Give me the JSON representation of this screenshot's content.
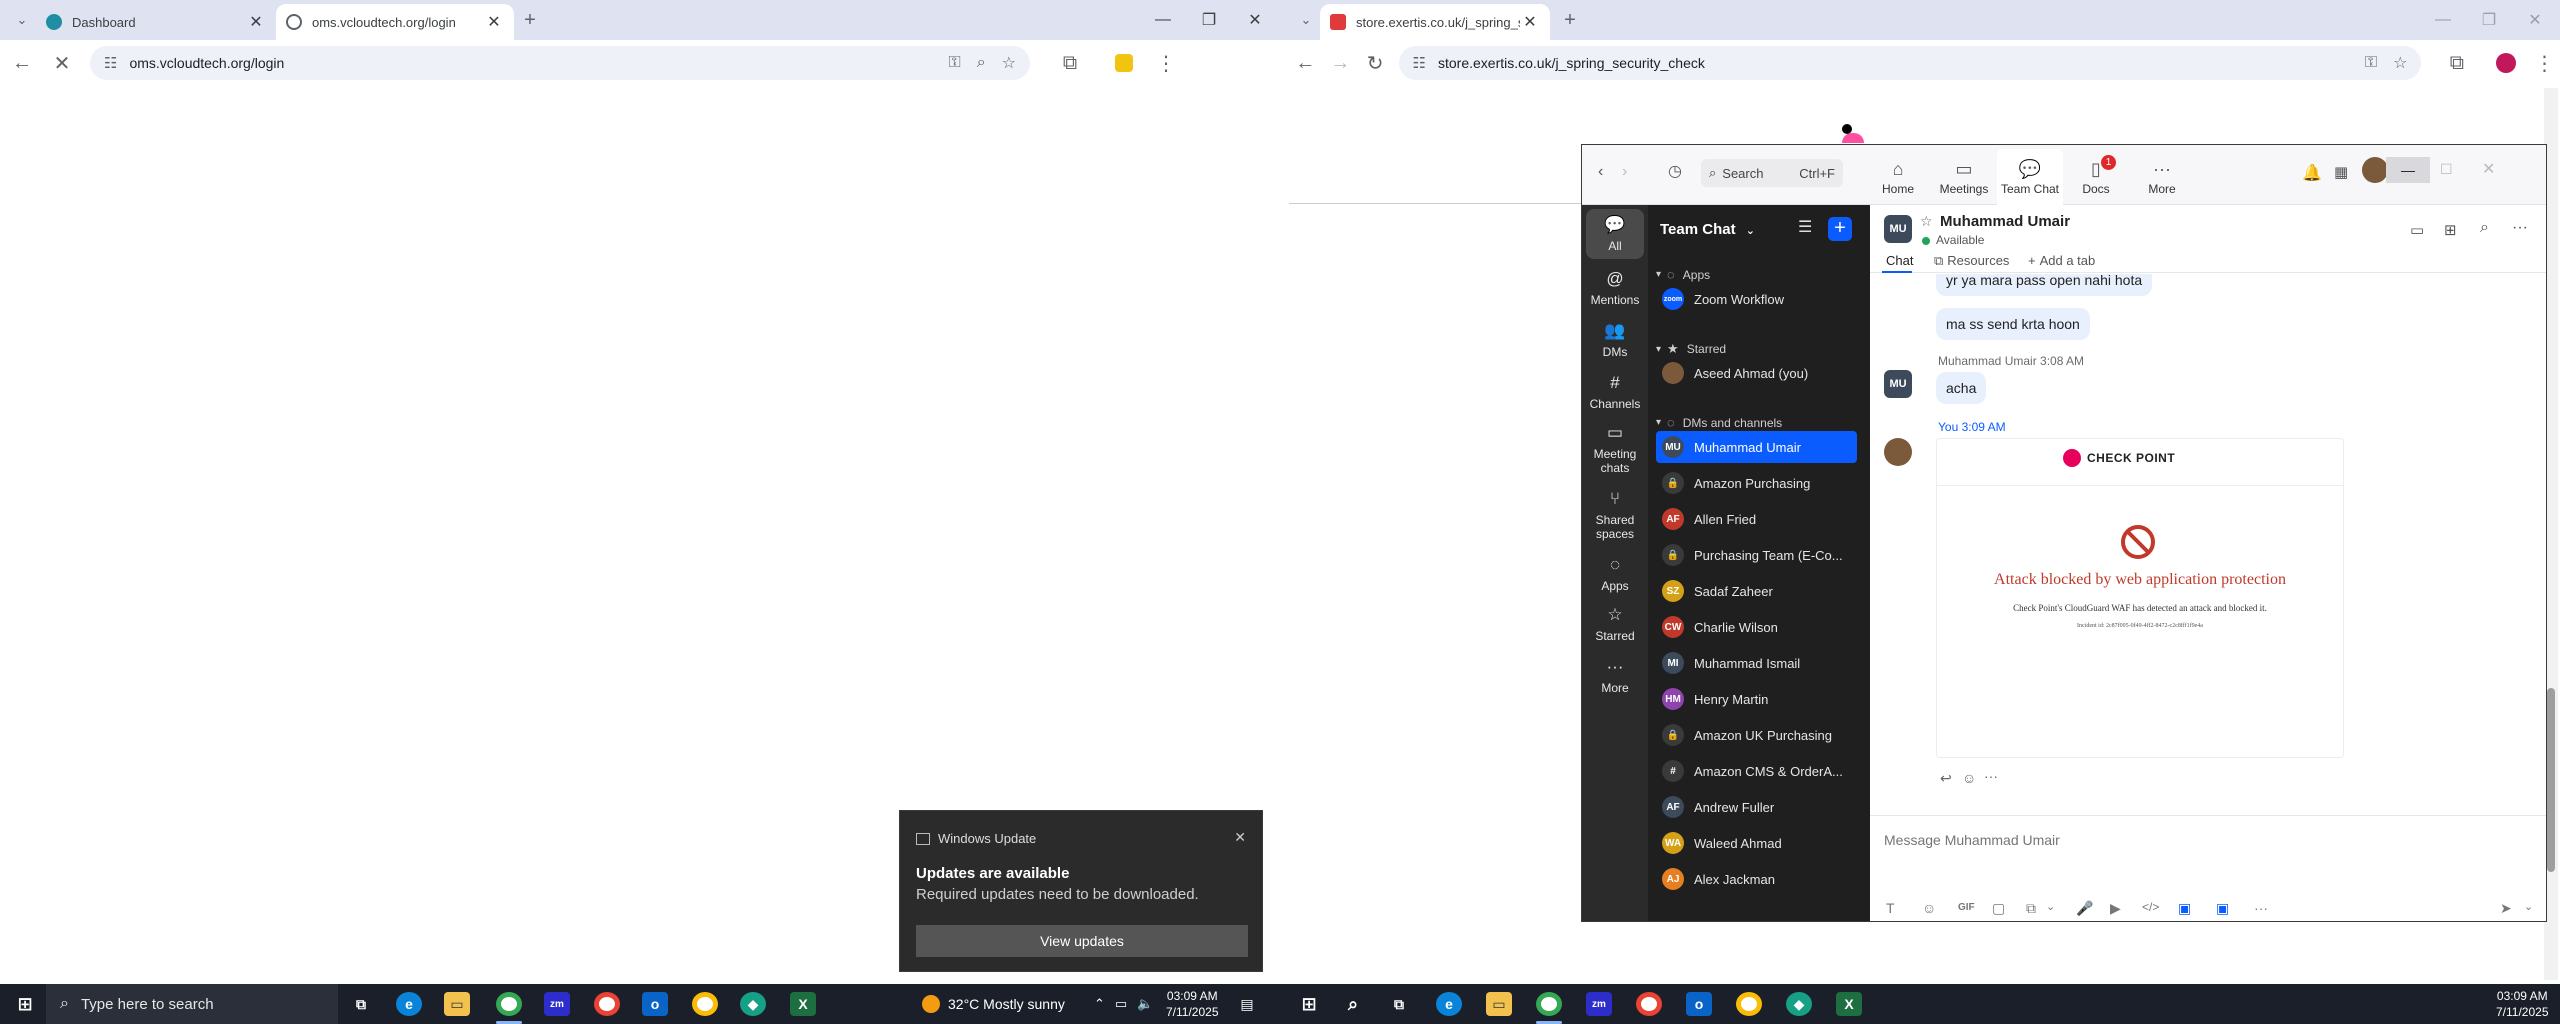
{
  "left_browser": {
    "tabs": [
      {
        "title": "Dashboard",
        "close": "✕"
      },
      {
        "title": "oms.vcloudtech.org/login",
        "close": "✕"
      }
    ],
    "new_tab": "+",
    "url": "oms.vcloudtech.org/login",
    "controls": {
      "minimize": "—",
      "restore": "❐",
      "close": "✕"
    }
  },
  "right_browser": {
    "tabs": [
      {
        "title": "store.exertis.co.uk/j_spring_secu",
        "close": "✕"
      }
    ],
    "new_tab": "+",
    "url": "store.exertis.co.uk/j_spring_security_check",
    "controls": {
      "minimize": "—",
      "restore": "❐",
      "close": "✕"
    }
  },
  "zoom": {
    "search": {
      "label": "Search",
      "shortcut": "Ctrl+F"
    },
    "nav": [
      {
        "label": "Home",
        "icon": "home-icon"
      },
      {
        "label": "Meetings",
        "icon": "video-icon"
      },
      {
        "label": "Team Chat",
        "icon": "chat-icon"
      },
      {
        "label": "Docs",
        "icon": "docs-icon",
        "badge": "1"
      },
      {
        "label": "More",
        "icon": "more-icon"
      }
    ],
    "rail": [
      {
        "label": "All",
        "icon": "💬"
      },
      {
        "label": "Mentions",
        "icon": "@"
      },
      {
        "label": "DMs",
        "icon": "👥"
      },
      {
        "label": "Channels",
        "icon": "#"
      },
      {
        "label": "Meeting chats",
        "icon": "▭"
      },
      {
        "label": "Shared spaces",
        "icon": "⑂"
      },
      {
        "label": "Apps",
        "icon": "◌"
      },
      {
        "label": "Starred",
        "icon": "☆"
      },
      {
        "label": "More",
        "icon": "···"
      }
    ],
    "list_title": "Team Chat",
    "sections": {
      "apps": "Apps",
      "starred": "Starred",
      "dms": "DMs and channels"
    },
    "app_items": [
      {
        "label": "Zoom Workflow",
        "avatar": "zoom",
        "color": "#0b5cff"
      }
    ],
    "starred_items": [
      {
        "label": "Aseed Ahmad (you)",
        "avatar": "",
        "color": "#7a5a3a"
      }
    ],
    "dm_items": [
      {
        "label": "Muhammad Umair",
        "avatar": "MU",
        "color": "#3d4a5c"
      },
      {
        "label": "Amazon Purchasing",
        "avatar": "🔒",
        "color": "#3a3a3a"
      },
      {
        "label": "Allen Fried",
        "avatar": "AF",
        "color": "#c0392b"
      },
      {
        "label": "Purchasing Team (E-Co...",
        "avatar": "🔒",
        "color": "#3a3a3a"
      },
      {
        "label": "Sadaf Zaheer",
        "avatar": "SZ",
        "color": "#d4a017"
      },
      {
        "label": "Charlie Wilson",
        "avatar": "CW",
        "color": "#c0392b"
      },
      {
        "label": "Muhammad Ismail",
        "avatar": "MI",
        "color": "#3d4a5c"
      },
      {
        "label": "Henry Martin",
        "avatar": "HM",
        "color": "#8e44ad"
      },
      {
        "label": "Amazon UK Purchasing",
        "avatar": "🔒",
        "color": "#3a3a3a"
      },
      {
        "label": "Amazon CMS & OrderA...",
        "avatar": "#",
        "color": "#3a3a3a"
      },
      {
        "label": "Andrew Fuller",
        "avatar": "AF",
        "color": "#3d4a5c"
      },
      {
        "label": "Waleed Ahmad",
        "avatar": "WA",
        "color": "#d4a017"
      },
      {
        "label": "Alex Jackman",
        "avatar": "AJ",
        "color": "#e67e22"
      }
    ],
    "chat": {
      "contact_name": "Muhammad Umair",
      "contact_initials": "MU",
      "status": "Available",
      "tabs": [
        "Chat",
        "Resources",
        "Add a tab"
      ],
      "messages": {
        "partial": "yr ya mara pass open nahi hota",
        "m2": "ma ss send krta hoon",
        "sender_meta": "Muhammad Umair 3:08 AM",
        "m3": "acha",
        "you_meta": "You 3:09 AM"
      },
      "card": {
        "brand": "CHECK POINT",
        "headline": "Attack blocked by web application protection",
        "body": "Check Point's CloudGuard WAF has detected an attack and blocked it.",
        "incident": "Incident id: 2c87f095-0f49-4ff2-8472-c2c8fff1f9e4a"
      },
      "composer_placeholder": "Message Muhammad Umair",
      "composer_tools": [
        "T",
        "☺",
        "GIF",
        "▢",
        "⧉",
        "🎤",
        "▶",
        "</>",
        "▣",
        "▣",
        "···"
      ]
    }
  },
  "toast": {
    "app": "Windows Update",
    "title": "Updates are available",
    "body": "Required updates need to be downloaded.",
    "button": "View updates",
    "close": "✕"
  },
  "taskbar": {
    "search_placeholder": "Type here to search",
    "weather": "32°C  Mostly sunny",
    "left_time": "03:09 AM",
    "left_date": "7/11/2025",
    "right_time": "03:09 AM",
    "right_date": "7/11/2025"
  }
}
